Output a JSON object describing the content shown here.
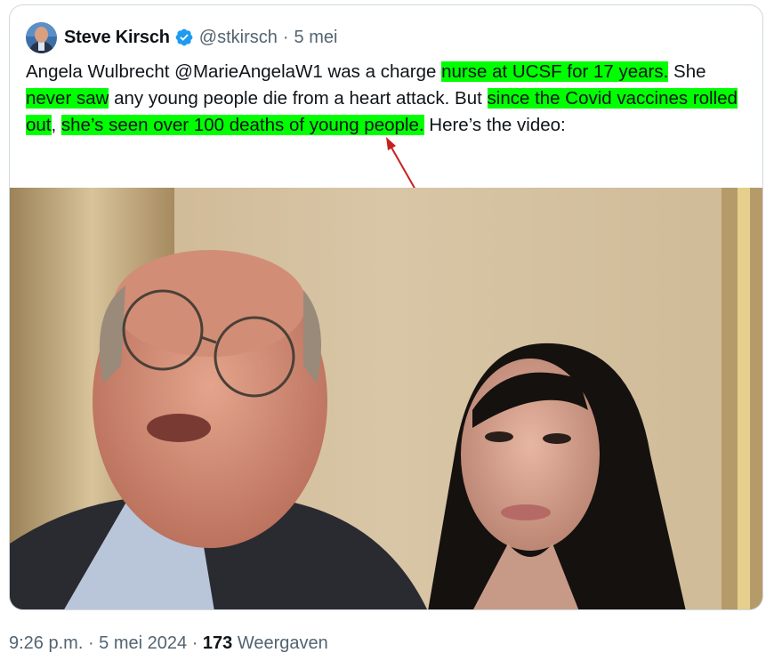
{
  "author": {
    "display_name": "Steve Kirsch",
    "handle": "@stkirsch",
    "separator": "·",
    "date": "5 mei",
    "avatar_icon": "profile-photo",
    "verified_icon": "verified-badge-icon",
    "verified_color": "#1d9bf0"
  },
  "tweet": {
    "segments": [
      {
        "text": "Angela Wulbrecht @MarieAngelaW1 was a charge ",
        "highlight": false
      },
      {
        "text": "nurse at UCSF for 17 years.",
        "highlight": true
      },
      {
        "text": " She",
        "highlight": false
      },
      {
        "text": " never saw",
        "highlight": true
      },
      {
        "text": " any young people die from a heart attack. But ",
        "highlight": false
      },
      {
        "text": "since the Covid vaccines rolled out",
        "highlight": true
      },
      {
        "text": ", ",
        "highlight": false
      },
      {
        "text": "she’s seen over 100 deaths of young people.",
        "highlight": true
      },
      {
        "text": " Here’s the video:",
        "highlight": false
      }
    ],
    "highlight_color": "#00ff00",
    "annotation": "red-arrow-pointing-to-highlight"
  },
  "media": {
    "type": "video-still",
    "description_icon": "video-thumbnail"
  },
  "footer": {
    "time": "9:26 p.m.",
    "sep1": " · ",
    "date": "5 mei 2024",
    "sep2": " · ",
    "views_count": "173",
    "views_label": " Weergaven"
  }
}
